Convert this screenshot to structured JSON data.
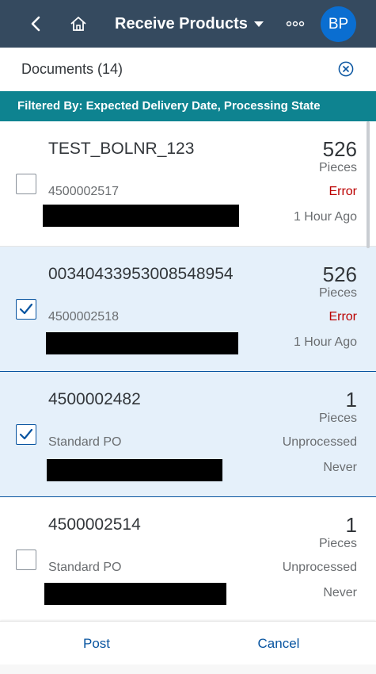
{
  "shell": {
    "title": "Receive Products",
    "avatar_initials": "BP",
    "colors": {
      "bar": "#354a5f",
      "avatar": "#0a6ed1"
    },
    "icons": [
      "back-icon",
      "home-icon",
      "caret-down-icon",
      "overflow-icon"
    ]
  },
  "documents": {
    "title": "Documents (14)",
    "clear_icon": "clear-filter-icon"
  },
  "filter": {
    "text": "Filtered By: Expected Delivery Date, Processing State",
    "color": "#0e8390"
  },
  "items": [
    {
      "doc": "TEST_BOLNR_123",
      "qty": "526",
      "unit": "Pieces",
      "sub": "4500002517",
      "state": "Error",
      "time": "1 Hour Ago",
      "selected": false
    },
    {
      "doc": "00340433953008548954",
      "qty": "526",
      "unit": "Pieces",
      "sub": "4500002518",
      "state": "Error",
      "time": "1 Hour Ago",
      "selected": true
    },
    {
      "doc": "4500002482",
      "qty": "1",
      "unit": "Pieces",
      "sub": "Standard PO",
      "state": "Unprocessed",
      "time": "Never",
      "selected": true
    },
    {
      "doc": "4500002514",
      "qty": "1",
      "unit": "Pieces",
      "sub": "Standard PO",
      "state": "Unprocessed",
      "time": "Never",
      "selected": false
    }
  ],
  "footer": {
    "post": "Post",
    "cancel": "Cancel"
  }
}
